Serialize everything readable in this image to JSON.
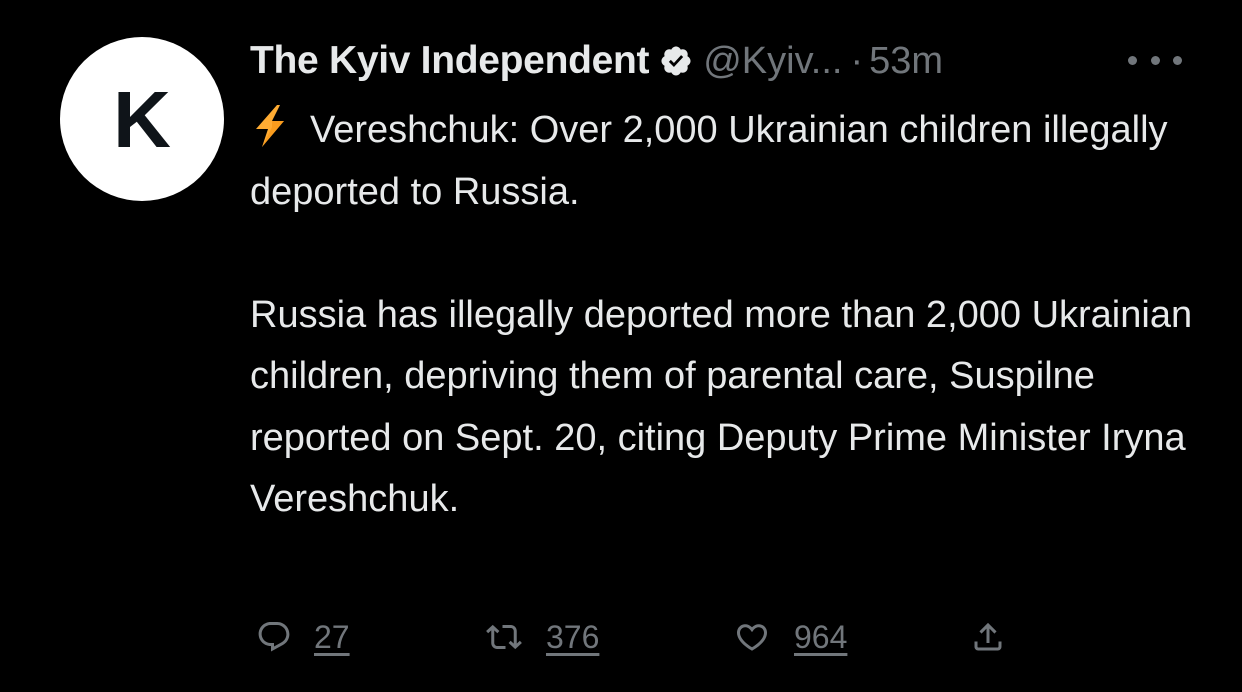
{
  "tweet": {
    "avatar_letter": "K",
    "display_name": "The Kyiv Independent",
    "handle": "@Kyiv...",
    "separator": "·",
    "time": "53m",
    "headline": "Vereshchuk: Over 2,000 Ukrainian children illegally deported to Russia.",
    "paragraph": "Russia has illegally deported more than 2,000 Ukrainian children, depriving them of parental care, Suspilne reported on Sept. 20, citing Deputy Prime Minister Iryna Vereshchuk."
  },
  "actions": {
    "replies": "27",
    "retweets": "376",
    "likes": "964"
  },
  "icons": {
    "verified": "verified-badge-icon",
    "bolt": "lightning-bolt-icon",
    "more": "more-options-icon",
    "reply": "reply-icon",
    "retweet": "retweet-icon",
    "like": "heart-icon",
    "share": "share-icon"
  },
  "colors": {
    "background": "#000000",
    "text": "#e7e9ea",
    "secondary": "#71767b",
    "bolt": "#ffac33"
  }
}
